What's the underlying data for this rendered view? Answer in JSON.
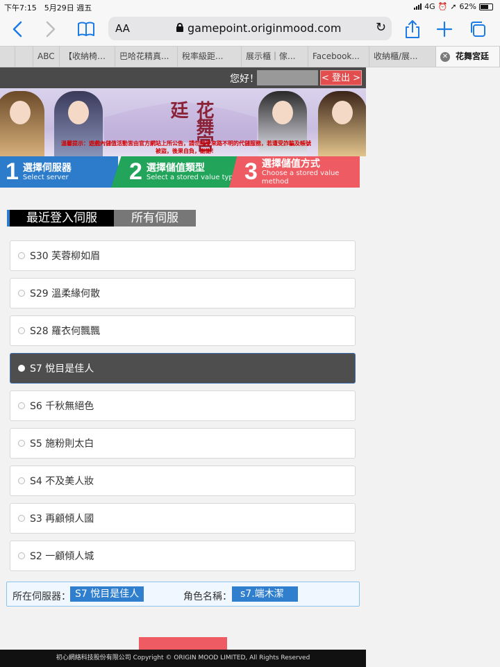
{
  "status": {
    "time_date": "下午7:15　5月29日 週五",
    "network": "4G",
    "battery": "62%"
  },
  "browser": {
    "aa_label": "AA",
    "url": "gamepoint.originmood.com",
    "tabs": [
      {
        "label": "ABC"
      },
      {
        "label": "【收納椅】..."
      },
      {
        "label": "巴哈花精真..."
      },
      {
        "label": "稅率級距..."
      },
      {
        "label": "展示櫃｜傢..."
      },
      {
        "label": "Facebook..."
      },
      {
        "label": "收納櫃/展..."
      },
      {
        "label": "花舞宮廷"
      }
    ]
  },
  "header": {
    "greeting": "您好！",
    "logout": "< 登出 >"
  },
  "banner": {
    "logo": "花舞宮廷",
    "warning": "溫馨提示：遊戲內儲值活動皆由官方網站上所公告，請勿接受來路不明的代儲服務，若遭受詐騙及帳號被盜，後果自負，謝謝！"
  },
  "steps": [
    {
      "num": "1",
      "title": "選擇伺服器",
      "sub": "Select server"
    },
    {
      "num": "2",
      "title": "選擇儲值類型",
      "sub": "Select a stored value type"
    },
    {
      "num": "3",
      "title": "選擇儲值方式",
      "sub": "Choose a stored value method"
    }
  ],
  "server_tabs": {
    "recent": "最近登入伺服",
    "all": "所有伺服"
  },
  "servers": [
    {
      "label": "S30 芙蓉柳如眉"
    },
    {
      "label": "S29 溫柔緣何散"
    },
    {
      "label": "S28 羅衣何飄飄"
    },
    {
      "label": "S7 悅目是佳人"
    },
    {
      "label": "S6 千秋無絕色"
    },
    {
      "label": "S5 施粉則太白"
    },
    {
      "label": "S4 不及美人妝"
    },
    {
      "label": "S3 再顧傾人國"
    },
    {
      "label": "S2 一顧傾人城"
    }
  ],
  "selected_server_index": 3,
  "info": {
    "server_label": "所在伺服器：",
    "server_value": "S7 悅目是佳人",
    "role_label": "角色名稱：",
    "role_value": "s7.端木潔"
  },
  "footer": "初心網絡科技股份有限公司 Copyright © ORIGIN MOOD LIMITED, All Rights Reserved",
  "colors": {
    "blue": "#2c7ccb",
    "green": "#22a55a",
    "red": "#ee5b62",
    "selected": "#4e4e4e"
  }
}
